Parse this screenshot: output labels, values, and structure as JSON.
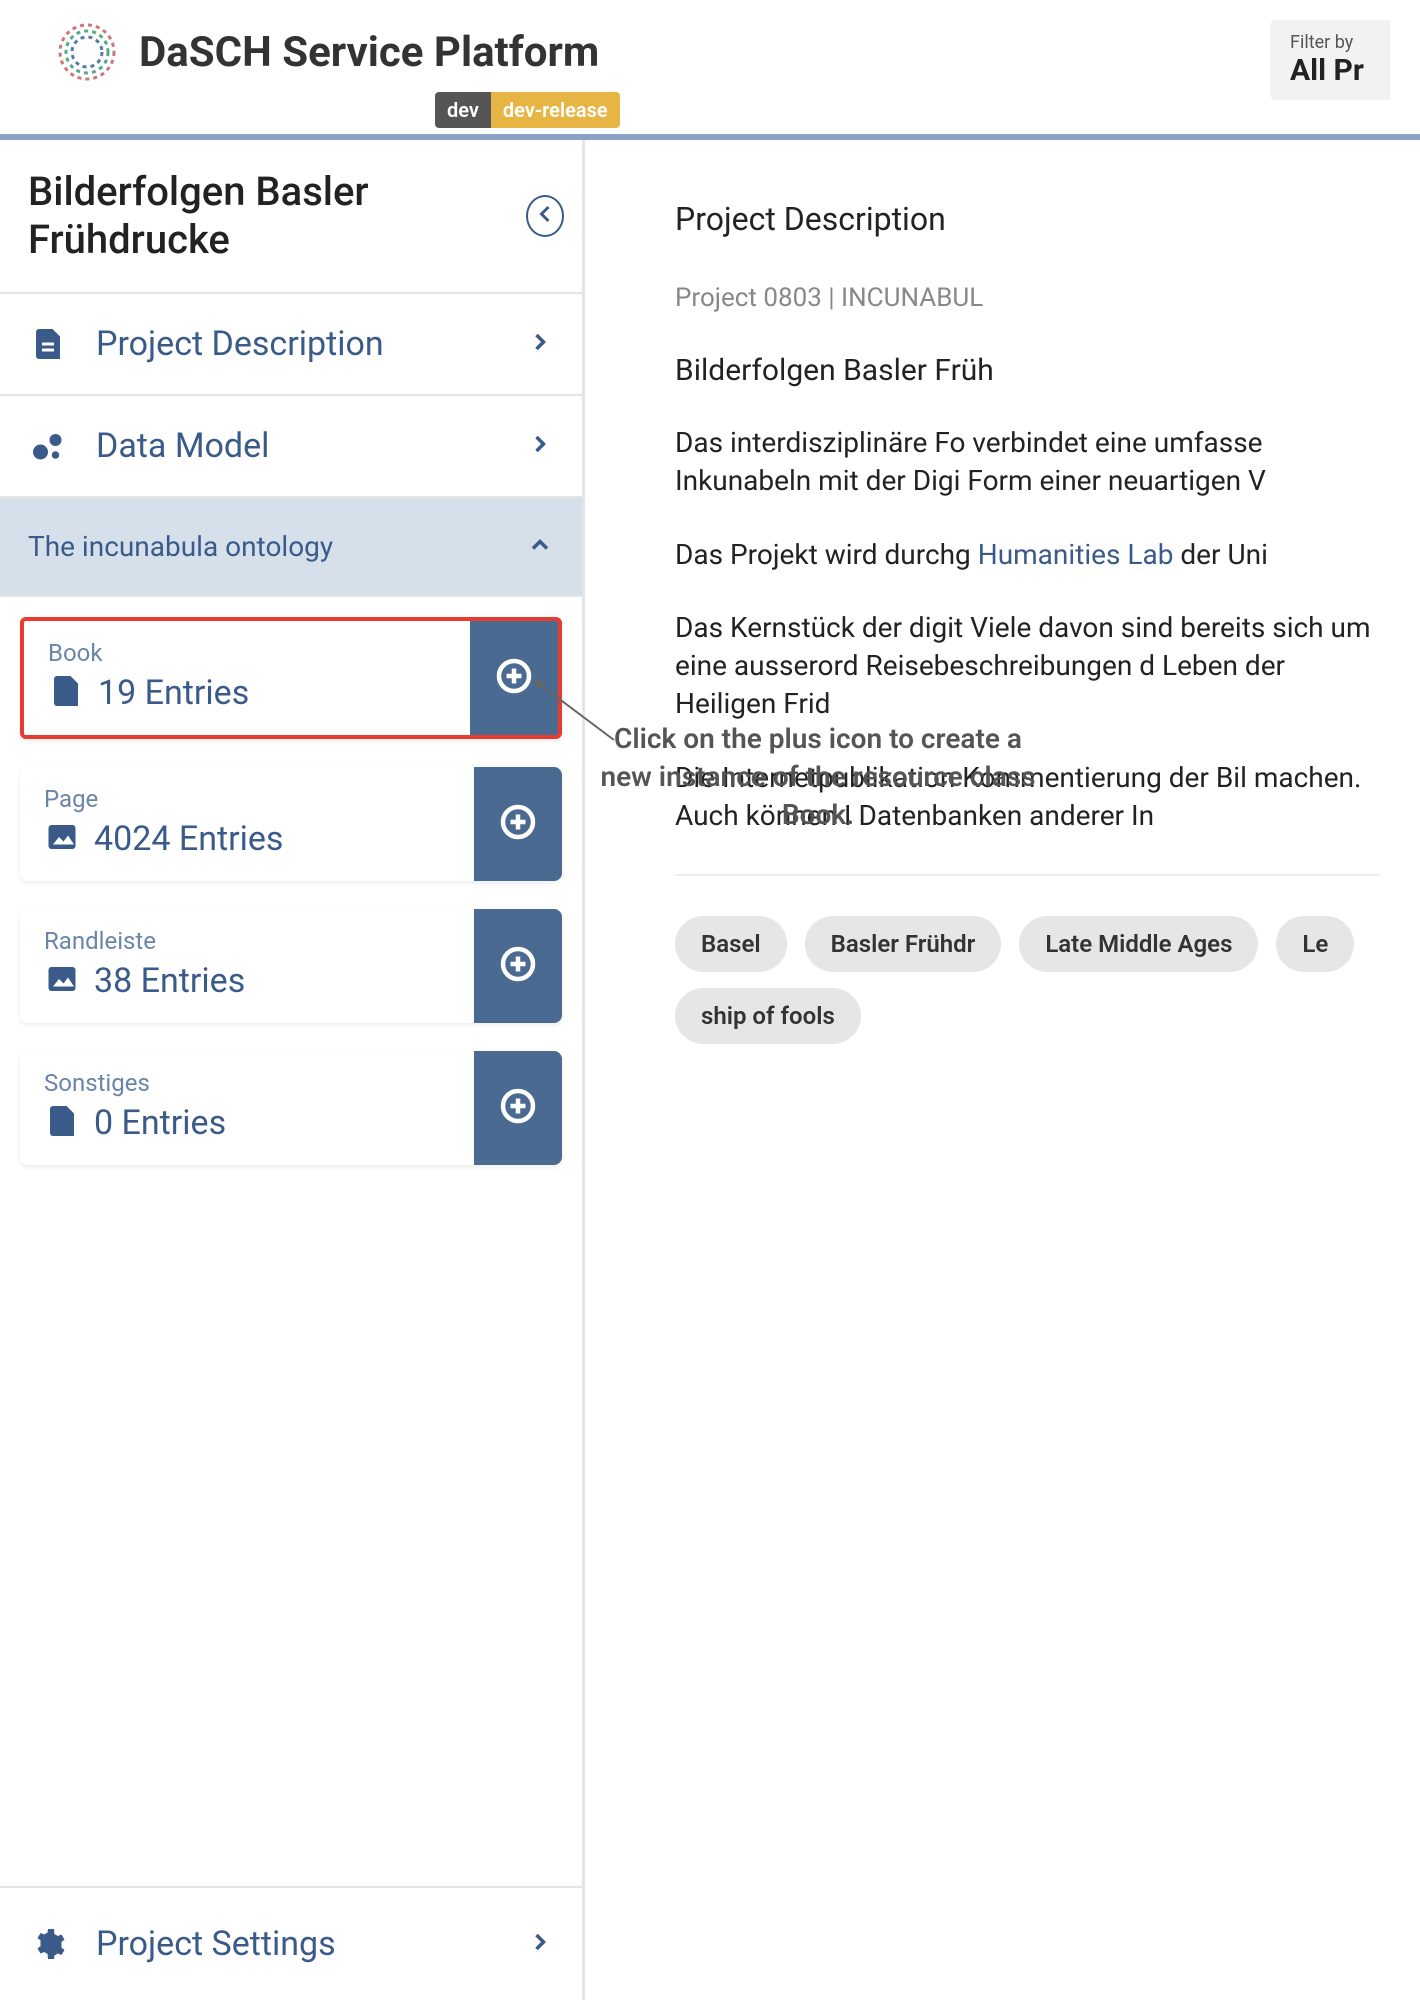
{
  "header": {
    "brand": "DaSCH Service Platform",
    "badges": {
      "dev": "dev",
      "release": "dev-release"
    },
    "filter_label": "Filter by",
    "filter_value": "All Pr"
  },
  "sidebar": {
    "project_title": "Bilderfolgen Basler Frühdrucke",
    "nav": [
      {
        "label": "Project Description"
      },
      {
        "label": "Data Model"
      }
    ],
    "ontology_title": "The incunabula ontology",
    "resources": [
      {
        "name": "Book",
        "count": "19 Entries",
        "icon": "file",
        "highlight": true
      },
      {
        "name": "Page",
        "count": "4024 Entries",
        "icon": "image",
        "highlight": false
      },
      {
        "name": "Randleiste",
        "count": "38 Entries",
        "icon": "image",
        "highlight": false
      },
      {
        "name": "Sonstiges",
        "count": "0 Entries",
        "icon": "file",
        "highlight": false
      }
    ],
    "settings_label": "Project Settings"
  },
  "annotation": {
    "text": "Click on the plus icon to create a new instance of the resource class Book."
  },
  "content": {
    "heading": "Project Description",
    "meta": "Project 0803 | INCUNABUL",
    "title": "Bilderfolgen Basler Früh",
    "paragraphs": [
      "Das interdisziplinäre Fo verbindet eine umfasse Inkunabeln mit der Digi Form einer neuartigen V",
      "Das Projekt wird durchg <a>Humanities Lab</a> der Uni",
      "Das Kernstück der digit Viele davon sind bereits sich um eine ausserord Reisebeschreibungen d Leben der Heiligen Frid",
      "Die Internetpublikation Kommentierung der Bil machen. Auch können I Datenbanken anderer In"
    ],
    "chips": [
      "Basel",
      "Basler Frühdr",
      "Late Middle Ages",
      "Le",
      "ship of fools"
    ]
  }
}
